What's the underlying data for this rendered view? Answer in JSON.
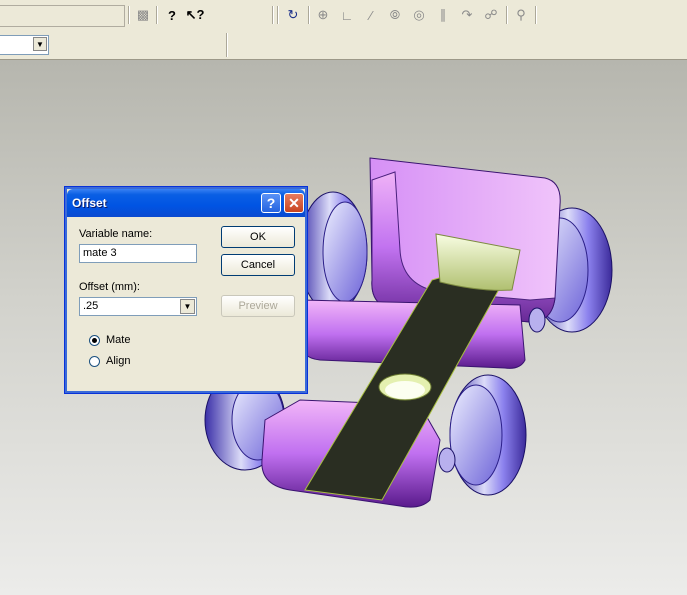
{
  "toolbar": {
    "icons": [
      "traffic-light-icon",
      "help-icon",
      "context-help-icon",
      "dimension-icon",
      "coordinate-icon",
      "angle-icon",
      "line-icon",
      "tangent-icon",
      "concentric-icon",
      "parallel-icon",
      "distance-icon",
      "constraint-icon",
      "zoom-icon"
    ]
  },
  "dialog": {
    "title": "Offset",
    "variable_name_label": "Variable name:",
    "variable_name_value": "mate 3",
    "offset_label": "Offset (mm):",
    "offset_value": ".25",
    "ok_label": "OK",
    "cancel_label": "Cancel",
    "preview_label": "Preview",
    "mate_label": "Mate",
    "align_label": "Align",
    "selected_option": "Mate"
  }
}
